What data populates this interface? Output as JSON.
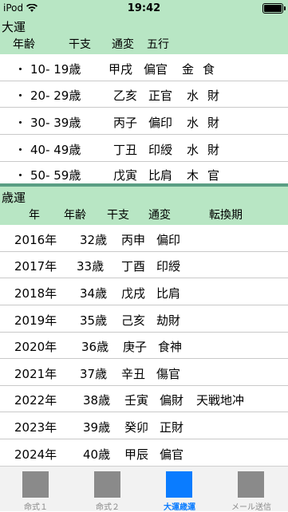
{
  "status": {
    "carrier": "iPod",
    "time": "19:42"
  },
  "daiun": {
    "title": "大運",
    "headers": [
      "年齢",
      "干支",
      "通変",
      "五行"
    ],
    "rows": [
      {
        "bullet": "・",
        "age": "10- 19歳",
        "kanshi": "甲戌",
        "tsuhen": "偏官",
        "gogyo": "金",
        "extra": "食"
      },
      {
        "bullet": "・",
        "age": "20- 29歳",
        "kanshi": "乙亥",
        "tsuhen": "正官",
        "gogyo": "水",
        "extra": "財"
      },
      {
        "bullet": "・",
        "age": "30- 39歳",
        "kanshi": "丙子",
        "tsuhen": "偏印",
        "gogyo": "水",
        "extra": "財"
      },
      {
        "bullet": "・",
        "age": "40- 49歳",
        "kanshi": "丁丑",
        "tsuhen": "印綬",
        "gogyo": "水",
        "extra": "財"
      },
      {
        "bullet": "・",
        "age": "50- 59歳",
        "kanshi": "戊寅",
        "tsuhen": "比肩",
        "gogyo": "木",
        "extra": "官"
      }
    ]
  },
  "saiun": {
    "title": "歳運",
    "headers": [
      "年",
      "年齢",
      "干支",
      "通変",
      "転換期"
    ],
    "rows": [
      {
        "year": "2016年",
        "age": "32歳",
        "kanshi": "丙申",
        "tsuhen": "偏印",
        "tenkan": ""
      },
      {
        "year": "2017年",
        "age": "33歳",
        "kanshi": "丁酉",
        "tsuhen": "印綬",
        "tenkan": ""
      },
      {
        "year": "2018年",
        "age": "34歳",
        "kanshi": "戊戌",
        "tsuhen": "比肩",
        "tenkan": ""
      },
      {
        "year": "2019年",
        "age": "35歳",
        "kanshi": "己亥",
        "tsuhen": "劫財",
        "tenkan": ""
      },
      {
        "year": "2020年",
        "age": "36歳",
        "kanshi": "庚子",
        "tsuhen": "食神",
        "tenkan": ""
      },
      {
        "year": "2021年",
        "age": "37歳",
        "kanshi": "辛丑",
        "tsuhen": "傷官",
        "tenkan": ""
      },
      {
        "year": "2022年",
        "age": "38歳",
        "kanshi": "壬寅",
        "tsuhen": "偏財",
        "tenkan": "天戦地冲"
      },
      {
        "year": "2023年",
        "age": "39歳",
        "kanshi": "癸卯",
        "tsuhen": "正財",
        "tenkan": ""
      },
      {
        "year": "2024年",
        "age": "40歳",
        "kanshi": "甲辰",
        "tsuhen": "偏官",
        "tenkan": ""
      }
    ]
  },
  "tabs": [
    {
      "label": "命式１",
      "active": false
    },
    {
      "label": "命式２",
      "active": false
    },
    {
      "label": "大運歳運",
      "active": true
    },
    {
      "label": "メール送信",
      "active": false
    }
  ],
  "colors": {
    "header_bg": "#b8e6c4",
    "divider": "#5a9e84",
    "active_tab": "#0a7cff",
    "inactive_tab": "#8a8a8a"
  }
}
